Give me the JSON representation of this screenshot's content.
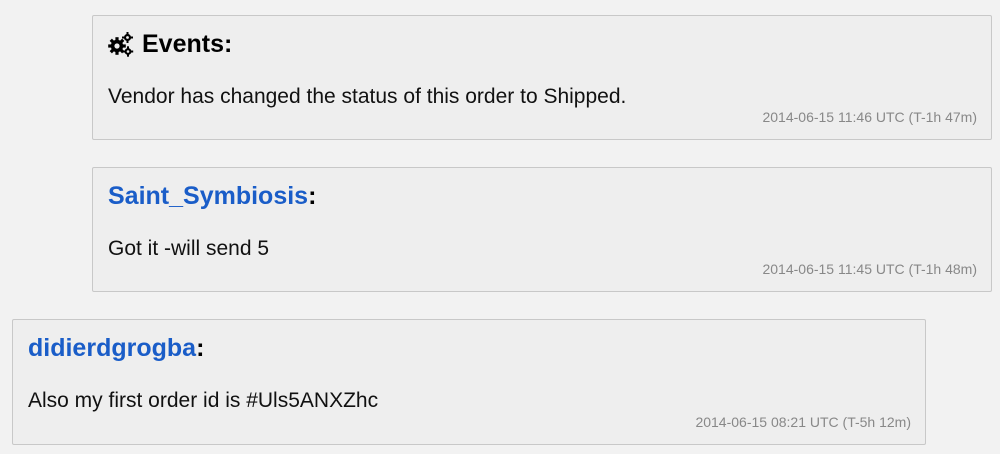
{
  "messages": [
    {
      "kind": "event",
      "icon": "gears-icon",
      "header": "Events:",
      "text": "Vendor has changed the status of this order to Shipped.",
      "timestamp": "2014-06-15 11:46 UTC (T-1h 47m)"
    },
    {
      "kind": "user",
      "username": "Saint_Symbiosis",
      "colon": ":",
      "text": "Got it -will send 5",
      "timestamp": "2014-06-15 11:45 UTC (T-1h 48m)"
    },
    {
      "kind": "user",
      "username": "didierdgrogba",
      "colon": ":",
      "text": "Also my first order id is #Uls5ANXZhc",
      "timestamp": "2014-06-15 08:21 UTC (T-5h 12m)"
    }
  ],
  "colors": {
    "username": "#1a5dc8",
    "background": "#f2f2f2",
    "panel": "#eeeeee",
    "timestamp": "#888888"
  }
}
